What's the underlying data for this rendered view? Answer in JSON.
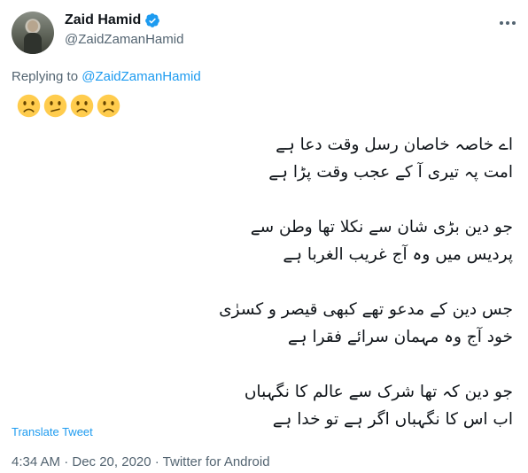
{
  "tweet": {
    "display_name": "Zaid Hamid",
    "handle": "@ZaidZamanHamid",
    "replying_prefix": "Replying to ",
    "replying_handle": "@ZaidZamanHamid",
    "emojis": [
      "slightly-frowning-face",
      "confused-face",
      "slightly-frowning-face",
      "slightly-frowning-face"
    ],
    "lines": [
      "اے خاصہ خاصان رسل وقت دعا ہے",
      "امت پہ تیری آ کے عجب وقت پڑا ہے",
      "",
      "جو دین بڑی شان سے نکلا تھا وطن سے",
      "پردیس میں وہ آج غریب الغربا ہے",
      "",
      "جس دین کے مدعو تھے کبھی قیصر و کسرٰی",
      "خود آج وہ مہمان سرائے فقرا ہے",
      "",
      "جو دین کہ تھا شرک سے عالم کا نگہباں",
      "اب اس کا نگہباں اگر ہے تو خدا ہے"
    ],
    "translate_label": "Translate Tweet",
    "timestamp": "4:34 AM · Dec 20, 2020 · Twitter for Android"
  },
  "colors": {
    "link": "#1d9bf0",
    "muted": "#536471",
    "text": "#0f1419",
    "emoji": "#ffcc4d"
  }
}
